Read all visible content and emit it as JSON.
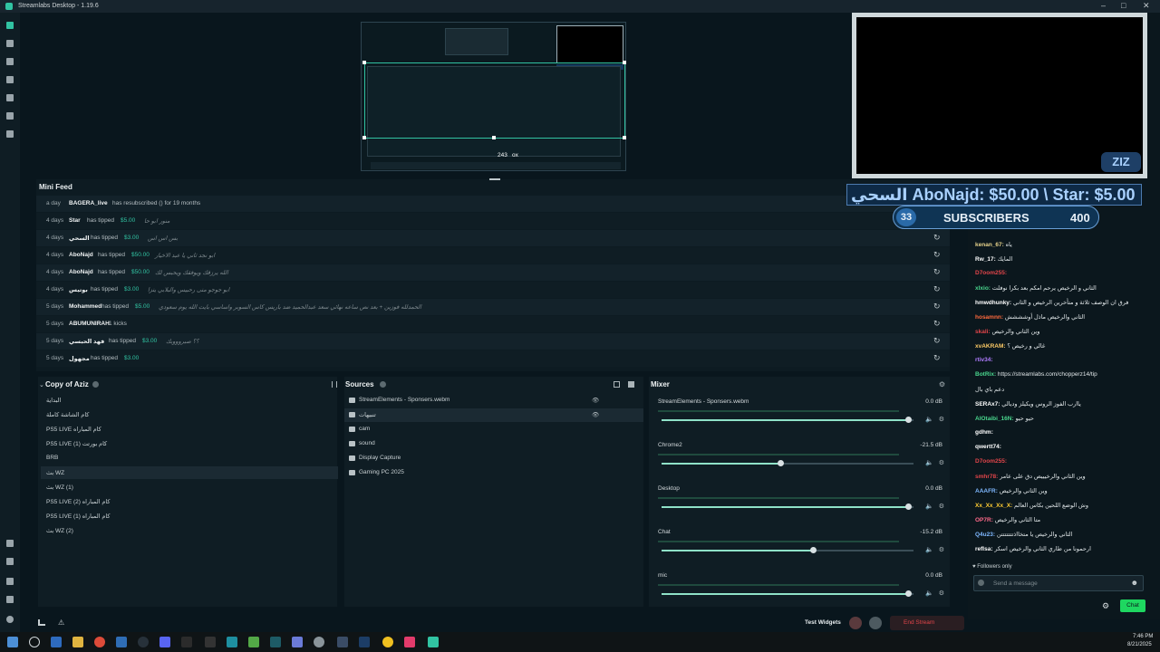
{
  "titlebar": {
    "title": "Streamlabs Desktop - 1.19.6",
    "controls": [
      "–",
      "□",
      "✕"
    ]
  },
  "preview": {
    "coord_readout": "243",
    "coord_suffix": "ox"
  },
  "mini_feed": {
    "title": "Mini Feed",
    "rows": [
      {
        "time": "a day",
        "name": "BAGERA_live",
        "msg": "has resubscribed () for 19 months",
        "amount": "",
        "note": ""
      },
      {
        "time": "4 days",
        "name": "Star",
        "msg": "has tipped",
        "amount": "$5.00",
        "note": "منور ابو حا"
      },
      {
        "time": "4 days",
        "name": "السحي",
        "msg": "has tipped",
        "amount": "$3.00",
        "note": "بس اس اس"
      },
      {
        "time": "4 days",
        "name": "AboNajd",
        "msg": "has tipped",
        "amount": "$50.00",
        "note": "ابو نجد ثاني يا عبد الاخيار"
      },
      {
        "time": "4 days",
        "name": "AboNajd",
        "msg": "has tipped",
        "amount": "$50.00",
        "note": "الله يرزقك ويوفقك ويحبس لك"
      },
      {
        "time": "4 days",
        "name": "بوتيس",
        "msg": "has tipped",
        "amount": "$3.00",
        "note": "ابو جوجو متى رحبيس والبلابي يتزا"
      },
      {
        "time": "5 days",
        "name": "Mohammed",
        "msg": "has tipped",
        "amount": "$5.00",
        "note": "الحمدلله فوزين + بعد نص ساعه نهائي سعد عبدالحميد ضد باريس كاس السوبر واساسي بايت الله يوم سعودي"
      },
      {
        "time": "5 days",
        "name": "ABUMUNIRAH",
        "msg": "1 kicks",
        "amount": "",
        "note": ""
      },
      {
        "time": "5 days",
        "name": "فهد الحبسي",
        "msg": "has tipped",
        "amount": "$3.00",
        "note": "؟؟ صبروووبك"
      },
      {
        "time": "5 days",
        "name": "مجهول",
        "msg": "has tipped",
        "amount": "$3.00",
        "note": ""
      }
    ]
  },
  "scenes": {
    "title": "Copy of Aziz",
    "items": [
      "البداية",
      "كام الشاشة كاملة",
      "PS5 LIVE كام المباراه",
      "PS5 LIVE (1) كام بورتت",
      "BRB",
      "بث WZ",
      "بث WZ (1)",
      "PS5 LIVE (2) كام المباراه",
      "PS5 LIVE (1) كام المباراه",
      "بث WZ (2)"
    ],
    "selected_index": 5
  },
  "sources": {
    "title": "Sources",
    "items": [
      "StreamElements - Sponsers.webm",
      "تنبيهات",
      "cam",
      "sound",
      "Display Capture",
      "Gaming PC 2025"
    ],
    "selected_index": 1
  },
  "mixer": {
    "title": "Mixer",
    "channels": [
      {
        "name": "StreamElements - Sponsers.webm",
        "db": "0.0 dB",
        "level": 0.98
      },
      {
        "name": "Chrome2",
        "db": "-21.5 dB",
        "level": 0.47
      },
      {
        "name": "Desktop",
        "db": "0.0 dB",
        "level": 0.98
      },
      {
        "name": "Chat",
        "db": "-15.2 dB",
        "level": 0.6
      },
      {
        "name": "mic",
        "db": "0.0 dB",
        "level": 0.98
      }
    ]
  },
  "footer": {
    "test_widgets": "Test Widgets",
    "end_stream": "End Stream"
  },
  "overlay": {
    "banner": "السحي AboNajd: $50.00 \\ Star: $5.00",
    "subs_left": "33",
    "subs_label": "SUBSCRIBERS",
    "subs_right": "400"
  },
  "chat": {
    "lines": [
      {
        "user": "kenan_67:",
        "text": "ياه",
        "color": "#e6d28b"
      },
      {
        "user": "Rw_17:",
        "text": "المايك",
        "color": "#ffffff"
      },
      {
        "user": "D7oom255:",
        "text": "",
        "color": "#e2454a"
      },
      {
        "user": "xlxio:",
        "text": "الثاني و الرخيص يرحم امكم بعد بكرا نوفلت",
        "color": "#4ad78e"
      },
      {
        "user": "hmwdhunky:",
        "text": "فرق ان الوصف ثلاثة و متأخرين الرخيص و الثاني",
        "color": "#ffffff"
      },
      {
        "user": "hosamnn:",
        "text": "الثاني والرخيص ماذل أوشششش",
        "color": "#ff6a3d"
      },
      {
        "user": "skali:",
        "text": "وين الثاني والرخيص",
        "color": "#e2454a"
      },
      {
        "user": "xvAKRAM:",
        "text": "غالي و رخيص ؟",
        "color": "#ffcc66"
      },
      {
        "user": "rtiv34:",
        "text": "",
        "color": "#b07cff"
      },
      {
        "user": "BotRix:",
        "text": "https://streamlabs.com/chopperz14/tip",
        "color": "#4ad78e"
      },
      {
        "user": "",
        "text": "دعم باي بال",
        "color": "#ffffff"
      },
      {
        "user": "SERAx7:",
        "text": "ياارب الفوز الروس ويكيلز وديالي",
        "color": "#ffffff"
      },
      {
        "user": "AlOtaibi_16N:",
        "text": "حيو حيو",
        "color": "#4ad78e"
      },
      {
        "user": "gdhm:",
        "text": "",
        "color": "#ffffff"
      },
      {
        "user": "qwertt74:",
        "text": "",
        "color": "#ffffff"
      },
      {
        "user": "D7oom255:",
        "text": "",
        "color": "#e2454a"
      },
      {
        "user": "smhr78:",
        "text": "وين الثاني والرخيييص دق على عامر",
        "color": "#e2454a"
      },
      {
        "user": "AAAFR:",
        "text": "وين الثاني والرخيص",
        "color": "#7fb8ff"
      },
      {
        "user": "Xx_Xx_Xx_X:",
        "text": "وش الوضع اللحين بكاس العالم",
        "color": "#ffcc33"
      },
      {
        "user": "OP7R:",
        "text": "متا الثاني والرخيص",
        "color": "#ff6a8a"
      },
      {
        "user": "Q4u23:",
        "text": "الثاني والرخيص يا متخااذتتتتتتتن",
        "color": "#7fb8ff"
      },
      {
        "user": "reflsa:",
        "text": "ارحمونا من طاري الثاني والرخيص اسكر",
        "color": "#ffffff"
      }
    ],
    "followers_only": "Followers only",
    "input_placeholder": "Send a message",
    "chat_button": "Chat"
  },
  "taskbar": {
    "time": "7:46 PM",
    "date": "8/21/2025"
  },
  "colors": {
    "accent": "#31c3a2",
    "chat_button": "#1ed760",
    "end_stream": "#e2454a"
  }
}
